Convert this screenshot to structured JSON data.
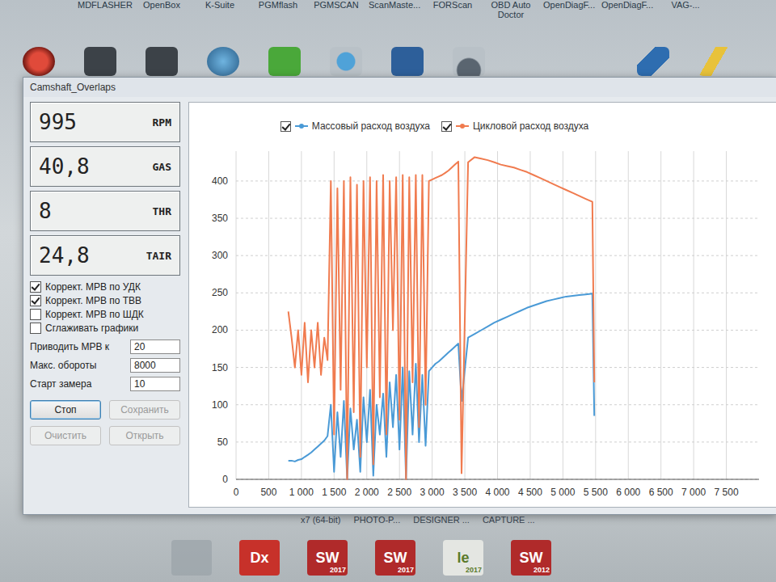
{
  "desktop": {
    "top_labels": [
      "MDFLASHER",
      "OpenBox",
      "K-Suite",
      "PGMflash",
      "PGMSCAN",
      "ScanMaste...",
      "FORScan",
      "OBD Auto Doctor",
      "OpenDiagF...",
      "OpenDiagF...",
      "VAG-..."
    ],
    "icon_row": [
      {
        "kind": "red"
      },
      {
        "kind": "dark"
      },
      {
        "kind": "dark"
      },
      {
        "kind": "globe"
      },
      {
        "kind": "green"
      },
      {
        "kind": "pin"
      },
      {
        "kind": "blue"
      },
      {
        "kind": "gauge"
      },
      {
        "kind": "blank"
      },
      {
        "kind": "blank"
      },
      {
        "kind": "arrow"
      },
      {
        "kind": "bolt"
      },
      {
        "kind": "blank"
      }
    ],
    "bottom_labels": [
      "x7 (64-bit)",
      "PHOTO-P...",
      "DESIGNER ...",
      "CAPTURE ..."
    ],
    "bottom_icons": [
      {
        "label": "Dx",
        "badge": ""
      },
      {
        "label": "SW",
        "badge": "2017"
      },
      {
        "label": "SW",
        "badge": "2017"
      },
      {
        "label": "le",
        "badge": "2017"
      },
      {
        "label": "SW",
        "badge": "2012"
      }
    ]
  },
  "window": {
    "title": "Camshaft_Overlaps"
  },
  "readouts": [
    {
      "value": "995",
      "unit": "RPM"
    },
    {
      "value": "40,8",
      "unit": "GAS"
    },
    {
      "value": "8",
      "unit": "THR"
    },
    {
      "value": "24,8",
      "unit": "TAIR"
    }
  ],
  "options": [
    {
      "label": "Коррект. МРВ по УДК",
      "checked": true
    },
    {
      "label": "Коррект. МРВ по ТВВ",
      "checked": true
    },
    {
      "label": "Коррект. МРВ по ШДК",
      "checked": false
    },
    {
      "label": "Сглаживать графики",
      "checked": false
    }
  ],
  "fields": [
    {
      "label": "Приводить МРВ к",
      "value": "20"
    },
    {
      "label": "Макс. обороты",
      "value": "8000"
    },
    {
      "label": "Старт замера",
      "value": "10"
    }
  ],
  "buttons": [
    {
      "label": "Стоп",
      "disabled": false,
      "focused": true
    },
    {
      "label": "Сохранить",
      "disabled": true,
      "focused": false
    },
    {
      "label": "Очистить",
      "disabled": true,
      "focused": false
    },
    {
      "label": "Открыть",
      "disabled": true,
      "focused": false
    }
  ],
  "chart": {
    "y_ticks": [
      "0",
      "50",
      "100",
      "150",
      "200",
      "250",
      "300",
      "350",
      "400"
    ],
    "x_ticks": [
      "0",
      "500",
      "1 000",
      "1 500",
      "2 000",
      "2 500",
      "3 000",
      "3 500",
      "4 000",
      "4 500",
      "5 000",
      "5 500",
      "6 000",
      "6 500",
      "7 000",
      "7 500"
    ],
    "x_rpm": [
      800,
      850,
      900,
      950,
      1000,
      1050,
      1100,
      1150,
      1200,
      1250,
      1300,
      1350,
      1400,
      1450,
      1500,
      1550,
      1600,
      1650,
      1700,
      1750,
      1800,
      1850,
      1900,
      1950,
      2000,
      2050,
      2100,
      2150,
      2200,
      2250,
      2300,
      2350,
      2400,
      2450,
      2500,
      2550,
      2600,
      2650,
      2700,
      2750,
      2800,
      2850,
      2900,
      2950,
      3000,
      3050,
      3100,
      3150,
      3200,
      3250,
      3300,
      3350,
      3400,
      3450,
      3550,
      3650,
      3750,
      3850,
      3950,
      4050,
      4150,
      4250,
      4350,
      4450,
      4550,
      4650,
      4750,
      4850,
      4950,
      5050,
      5150,
      5250,
      5350,
      5450,
      5480
    ],
    "series": [
      {
        "name": "Массовый расход воздуха",
        "checked": true,
        "color": "#4a9ad6",
        "values": [
          25,
          25,
          24,
          26,
          27,
          30,
          33,
          36,
          40,
          44,
          48,
          52,
          58,
          100,
          10,
          90,
          30,
          105,
          0,
          95,
          40,
          80,
          10,
          110,
          50,
          120,
          5,
          100,
          60,
          115,
          30,
          130,
          70,
          140,
          40,
          150,
          0,
          145,
          60,
          155,
          50,
          140,
          45,
          145,
          150,
          155,
          158,
          162,
          166,
          170,
          174,
          178,
          182,
          105,
          190,
          195,
          200,
          205,
          210,
          214,
          218,
          222,
          226,
          230,
          233,
          236,
          239,
          241,
          243,
          245,
          246,
          247,
          248,
          249,
          85
        ]
      },
      {
        "name": "Цикловой расход воздуха",
        "checked": true,
        "color": "#f07b4f",
        "values": [
          225,
          190,
          150,
          200,
          140,
          210,
          130,
          200,
          150,
          210,
          140,
          190,
          160,
          400,
          60,
          390,
          120,
          400,
          0,
          405,
          90,
          395,
          30,
          400,
          150,
          405,
          20,
          400,
          110,
          408,
          60,
          400,
          200,
          405,
          80,
          408,
          0,
          405,
          130,
          408,
          70,
          408,
          100,
          400,
          402,
          404,
          406,
          408,
          411,
          414,
          418,
          422,
          426,
          8,
          425,
          432,
          430,
          428,
          425,
          422,
          420,
          418,
          415,
          412,
          408,
          404,
          400,
          396,
          392,
          388,
          384,
          380,
          376,
          372,
          130
        ]
      }
    ]
  }
}
